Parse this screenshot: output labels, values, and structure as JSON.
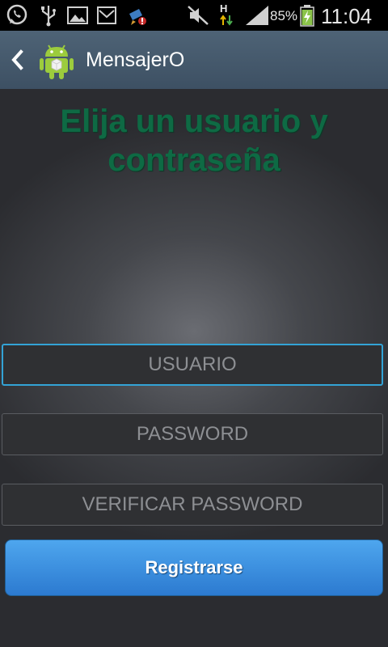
{
  "status_bar": {
    "battery": "85%",
    "time": "11:04",
    "network_type": "H",
    "icons": [
      "whatsapp-icon",
      "usb-icon",
      "gallery-icon",
      "mail-icon",
      "cleaner-icon",
      "mute-icon",
      "network-h-icon",
      "signal-icon",
      "battery-charging-icon"
    ]
  },
  "action_bar": {
    "title": "MensajerO"
  },
  "form": {
    "heading": "Elija un usuario y contraseña",
    "username_placeholder": "USUARIO",
    "password_placeholder": "PASSWORD",
    "verify_placeholder": "VERIFICAR PASSWORD",
    "register_label": "Registrarse"
  },
  "colors": {
    "heading": "#0e6a44",
    "action_bar": "#4e6376",
    "button": "#3b8fe0",
    "focus_border": "#33a3d6"
  }
}
